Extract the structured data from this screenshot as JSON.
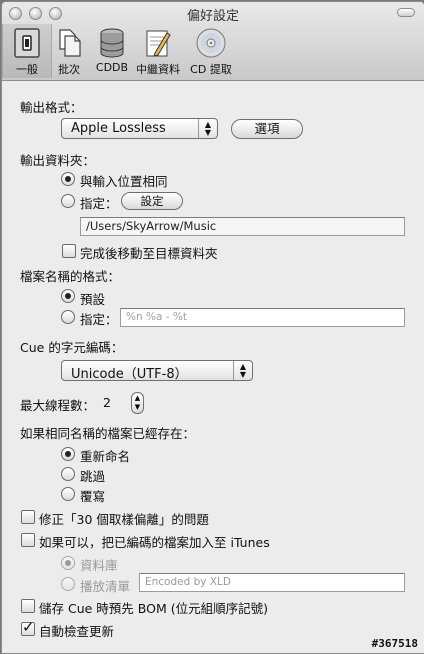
{
  "window": {
    "title": "偏好設定"
  },
  "toolbar": {
    "items": [
      {
        "label": "一般",
        "icon": "general-switch-icon"
      },
      {
        "label": "批次",
        "icon": "batch-documents-icon"
      },
      {
        "label": "CDDB",
        "icon": "database-icon"
      },
      {
        "label": "中繼資料",
        "icon": "metadata-pencil-icon"
      },
      {
        "label": "CD 提取",
        "icon": "cd-disc-icon"
      }
    ]
  },
  "output_format": {
    "label": "輸出格式：",
    "selected": "Apple Lossless",
    "options_button": "選項"
  },
  "output_folder": {
    "label": "輸出資料夾：",
    "same_as_input": "與輸入位置相同",
    "specify": "指定：",
    "set_button": "設定",
    "path": "/Users/SkyArrow/Music",
    "move_after": "完成後移動至目標資料夾"
  },
  "filename_format": {
    "label": "檔案名稱的格式：",
    "default": "預設",
    "specify": "指定：",
    "placeholder": "%n %a - %t"
  },
  "cue_encoding": {
    "label": "Cue 的字元編碼：",
    "selected": "Unicode（UTF-8）"
  },
  "max_threads": {
    "label": "最大線程數：",
    "value": "2"
  },
  "existing_file": {
    "label": "如果相同名稱的檔案已經存在：",
    "rename": "重新命名",
    "skip": "跳過",
    "overwrite": "覆寫"
  },
  "options": {
    "fix_offset": "修正「30 個取樣偏離」的問題",
    "add_itunes": "如果可以，把已編碼的檔案加入至 iTunes",
    "library": "資料庫",
    "playlist": "播放清單",
    "playlist_placeholder": "Encoded by XLD",
    "cue_bom": "儲存 Cue 時預先 BOM (位元組順序記號)",
    "auto_update": "自動檢查更新"
  },
  "watermark": "#367518"
}
